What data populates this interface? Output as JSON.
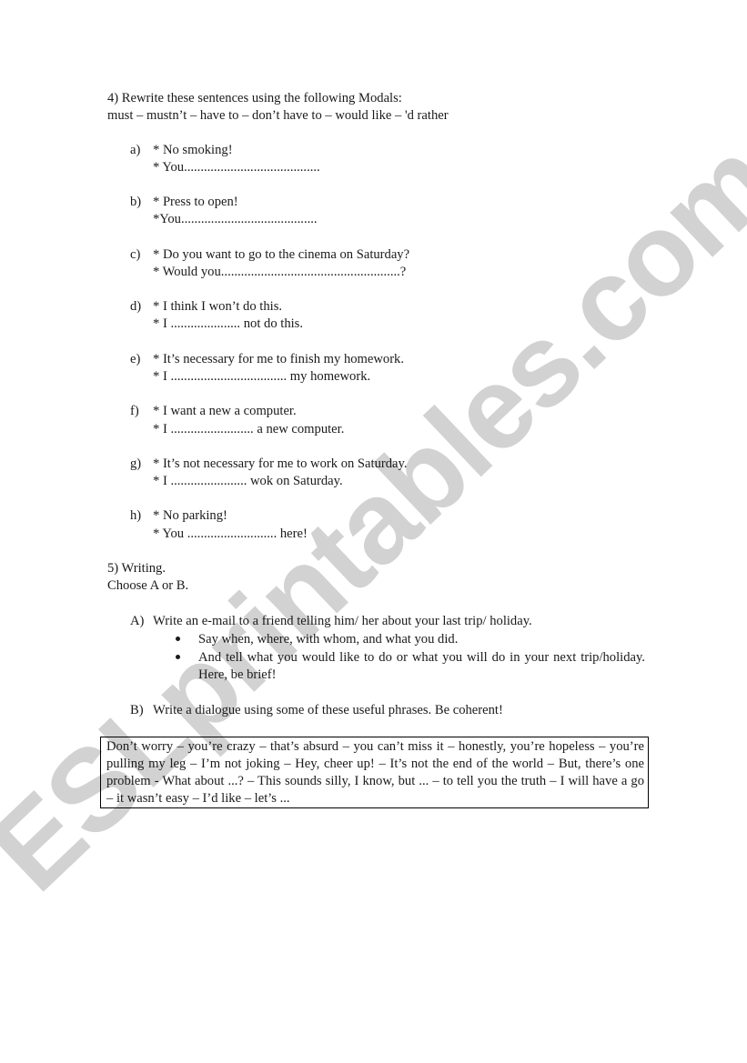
{
  "watermark": "ESLprintables.com",
  "section4": {
    "title": "4) Rewrite these sentences using the following Modals:",
    "modals": "must – mustn’t – have to – don’t have to – would like – 'd rather",
    "items": [
      {
        "letter": "a)",
        "prompt": "* No smoking!",
        "answer": "* You........................................."
      },
      {
        "letter": "b)",
        "prompt": "* Press to open!",
        "answer": "*You........................................."
      },
      {
        "letter": "c)",
        "prompt": "* Do you want to go to the cinema on Saturday?",
        "answer": "* Would you......................................................?"
      },
      {
        "letter": "d)",
        "prompt": "* I think I won’t do this.",
        "answer": "* I ..................... not do this."
      },
      {
        "letter": "e)",
        "prompt": "* It’s necessary for me to finish my homework.",
        "answer": "* I ................................... my homework."
      },
      {
        "letter": "f)",
        "prompt": "* I want a new a computer.",
        "answer": "* I ......................... a new computer."
      },
      {
        "letter": "g)",
        "prompt": "* It’s not necessary for me to work on Saturday.",
        "answer": "* I ....................... wok on Saturday."
      },
      {
        "letter": "h)",
        "prompt": "* No parking!",
        "answer": "* You ........................... here!"
      }
    ]
  },
  "section5": {
    "title": "5) Writing.",
    "instruction": "Choose A or B.",
    "optionA": {
      "letter": "A)",
      "text": "Write an e-mail to a friend telling him/ her about your last trip/ holiday.",
      "bullets": [
        "Say when, where, with whom, and what you did.",
        "And tell what you would like to do or what you will do in your next trip/holiday. Here, be brief!"
      ]
    },
    "optionB": {
      "letter": "B)",
      "text": "Write a dialogue  using some of these useful phrases. Be coherent!"
    },
    "phrases": "Don’t worry – you’re crazy – that’s absurd – you can’t miss it – honestly, you’re hopeless – you’re pulling my leg – I’m not joking – Hey, cheer up! – It’s not the end of the world – But, there’s one problem - What about ...? – This sounds silly, I know, but ... –  to tell you the truth – I will have a go – it wasn’t easy – I’d like – let’s ..."
  }
}
